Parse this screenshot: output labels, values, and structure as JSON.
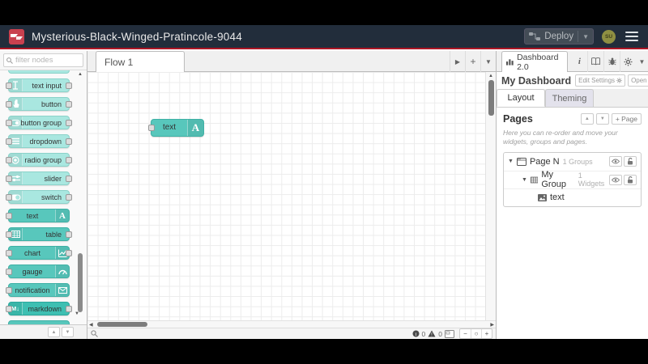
{
  "header": {
    "title": "Mysterious-Black-Winged-Pratincole-9044",
    "deploy_label": "Deploy",
    "avatar_initials": "SU"
  },
  "palette": {
    "filter_placeholder": "filter nodes",
    "nodes": [
      {
        "label": "text input"
      },
      {
        "label": "button"
      },
      {
        "label": "button group"
      },
      {
        "label": "dropdown"
      },
      {
        "label": "radio group"
      },
      {
        "label": "slider"
      },
      {
        "label": "switch"
      },
      {
        "label": "text"
      },
      {
        "label": "table"
      },
      {
        "label": "chart"
      },
      {
        "label": "gauge"
      },
      {
        "label": "notification"
      },
      {
        "label": "markdown"
      }
    ]
  },
  "workspace": {
    "tab_label": "Flow 1",
    "node_label": "text",
    "footer": {
      "info_count": "0",
      "warning_count": "0"
    }
  },
  "sidebar": {
    "tab_label": "Dashboard 2.0",
    "dashboard_title": "My Dashboard",
    "edit_settings_label": "Edit Settings",
    "open_dashboard_label": "Open Dashboard",
    "layout_tab": "Layout",
    "theming_tab": "Theming",
    "pages": {
      "heading": "Pages",
      "add_page_label": "+ Page",
      "help_text": "Here you can re-order and move your widgets, groups and pages.",
      "tree": {
        "page_label": "Page N",
        "page_meta": "1 Groups",
        "group_label": "My Group",
        "group_meta": "1 Widgets",
        "widget_label": "text"
      }
    }
  },
  "glyphs": {
    "up": "▲",
    "down": "▼",
    "left": "◀",
    "right": "▶",
    "caret": "▼",
    "minus": "−",
    "plus": "+",
    "circle": "○",
    "text_icon_letter": "A",
    "markdown_icon": "M↓",
    "info_i": "i"
  },
  "colors": {
    "header_bg": "#222d3b",
    "accent_red": "#ad1625",
    "node_teal_light": "#a9e7e0",
    "node_teal_dark": "#58c7bc"
  }
}
